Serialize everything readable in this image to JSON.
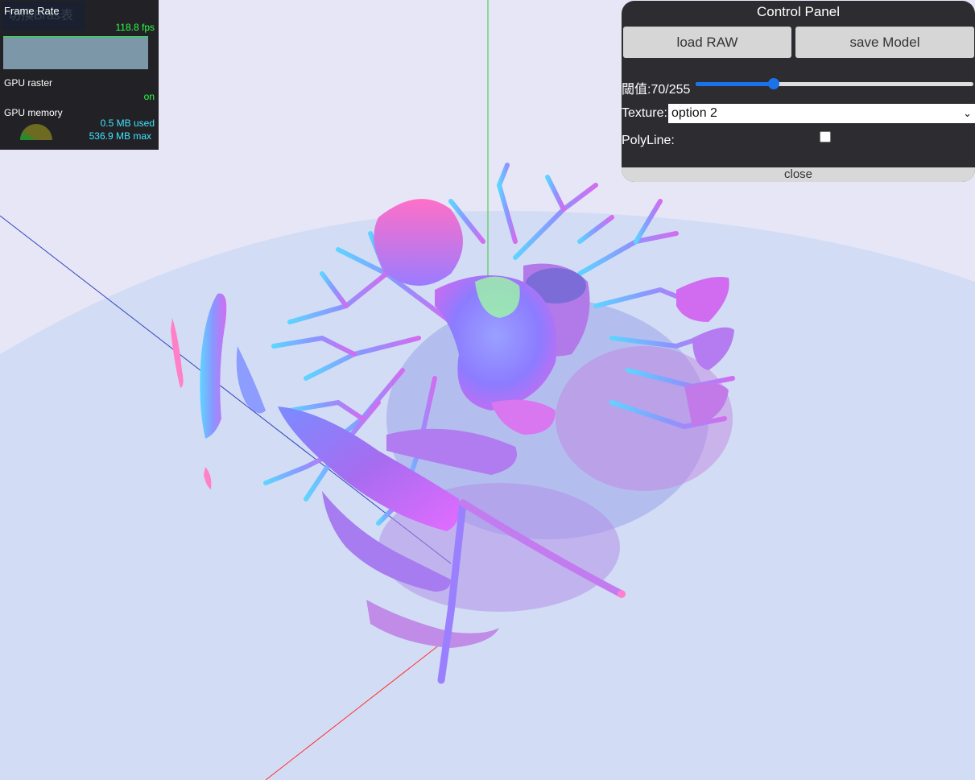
{
  "stats": {
    "title": "Frame Rate",
    "ghost_text": "切換Bras表",
    "fps": "118.8 fps",
    "gpu_raster_label": "GPU raster",
    "gpu_raster_value": "on",
    "gpu_memory_label": "GPU memory",
    "memory_used": "0.5 MB used",
    "memory_max": "536.9 MB max"
  },
  "control_panel": {
    "title": "Control Panel",
    "load_button": "load RAW",
    "save_button": "save Model",
    "threshold_label": "閾值:70/255",
    "threshold_value": 70,
    "threshold_max": 255,
    "texture_label": "Texture:",
    "texture_selected": "option 2",
    "polyline_label": "PolyLine:",
    "polyline_checked": false,
    "close_label": "close"
  },
  "colors": {
    "background": "#e6e6f7",
    "ground": "#d0dcf4",
    "axis_x": "#ff3030",
    "axis_y": "#33cc33",
    "axis_z": "#3344bb",
    "slider_accent": "#1a73e8"
  }
}
